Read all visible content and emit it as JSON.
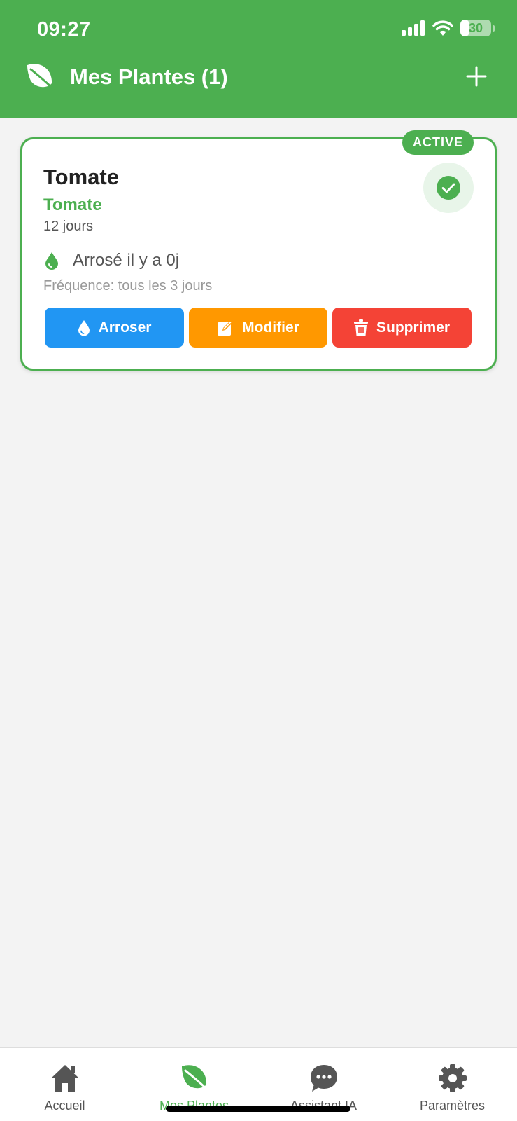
{
  "status_bar": {
    "time": "09:27",
    "battery": "30",
    "battery_level": 0.3
  },
  "header": {
    "title": "Mes Plantes (1)",
    "logo_icon": "leaf-icon",
    "add_icon": "plus-icon"
  },
  "plants": [
    {
      "name": "Tomate",
      "variety": "Tomate",
      "age": "12 jours",
      "badge": "ACTIVE",
      "watered": "Arrosé il y a 0j",
      "frequency": "Fréquence: tous les 3 jours",
      "actions": {
        "water": "Arroser",
        "edit": "Modifier",
        "delete": "Supprimer"
      }
    }
  ],
  "bottom_nav": [
    {
      "label": "Accueil",
      "icon": "home-icon",
      "active": false
    },
    {
      "label": "Mes Plantes",
      "icon": "leaf-icon",
      "active": true
    },
    {
      "label": "Assistant IA",
      "icon": "chat-icon",
      "active": false
    },
    {
      "label": "Paramètres",
      "icon": "gear-icon",
      "active": false
    }
  ],
  "colors": {
    "primary": "#4caf50",
    "water": "#2196f3",
    "edit": "#ff9800",
    "delete": "#f44336",
    "background": "#f3f3f3"
  }
}
